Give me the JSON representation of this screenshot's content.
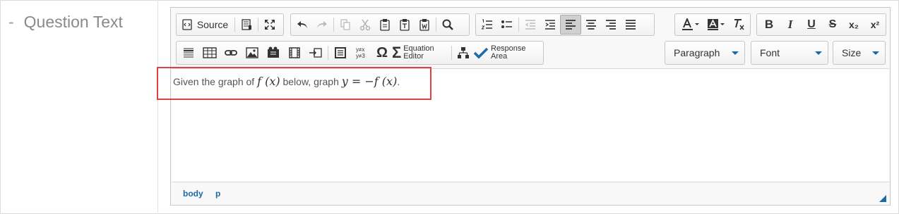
{
  "field_label": {
    "dash": "-",
    "text": "Question Text"
  },
  "toolbar": {
    "source_label": "Source",
    "equation_editor_label": [
      "Equation",
      "Editor"
    ],
    "response_area_label": [
      "Response",
      "Area"
    ],
    "sub_label": "x₂",
    "sup_label": "x²",
    "omega_label": "Ω",
    "sigma_label": "Σ",
    "bold_label": "B",
    "italic_label": "I",
    "underline_label": "U",
    "strike_label": "S",
    "paragraph_select": "Paragraph",
    "font_select": "Font",
    "size_select": "Size",
    "accent_color": "#1b6aa5"
  },
  "content": {
    "text_before": "Given the graph of ",
    "math_1": "f (x)",
    "text_middle": " below, graph ",
    "math_2": "y = −f (x)",
    "text_after": "."
  },
  "status_path": [
    "body",
    "p"
  ],
  "highlight_color": "#e04040"
}
